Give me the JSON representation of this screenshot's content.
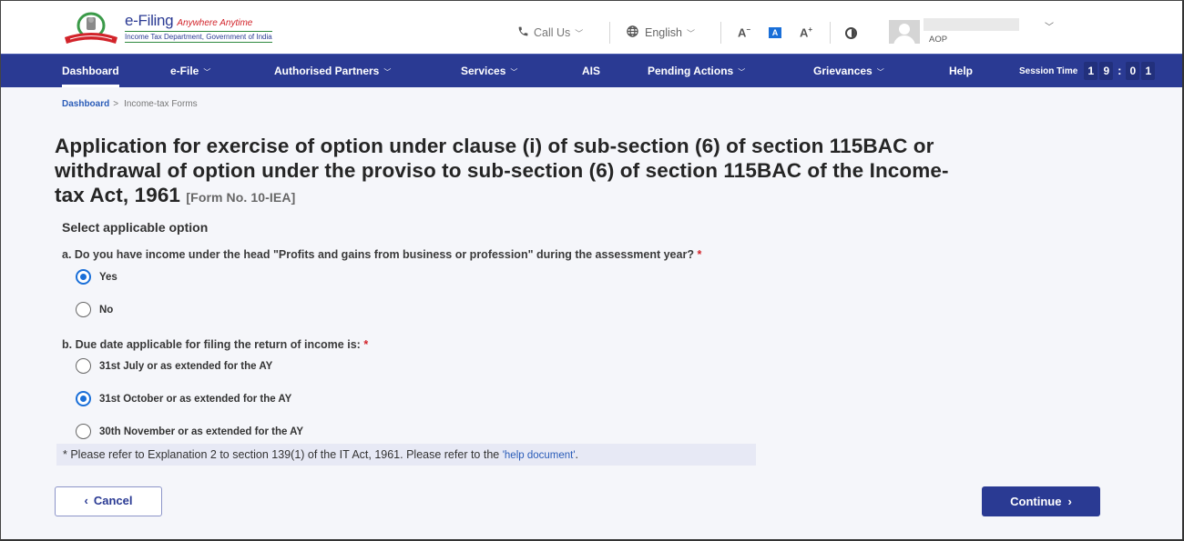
{
  "header": {
    "brand_title": "e-Filing",
    "brand_tagline": "Anywhere Anytime",
    "brand_subtitle": "Income Tax Department, Government of India",
    "call_us": "Call Us",
    "language": "English",
    "font_decrease": "A",
    "font_default": "A",
    "font_increase": "A",
    "user_role": "AOP"
  },
  "nav": {
    "items": [
      {
        "label": "Dashboard",
        "dropdown": false,
        "active": true
      },
      {
        "label": "e-File",
        "dropdown": true
      },
      {
        "label": "Authorised Partners",
        "dropdown": true
      },
      {
        "label": "Services",
        "dropdown": true
      },
      {
        "label": "AIS",
        "dropdown": false
      },
      {
        "label": "Pending Actions",
        "dropdown": true
      },
      {
        "label": "Grievances",
        "dropdown": true
      },
      {
        "label": "Help",
        "dropdown": false
      }
    ],
    "session_label": "Session Time",
    "session_digits": [
      "1",
      "9",
      "0",
      "1"
    ],
    "session_separator": ":"
  },
  "breadcrumb": {
    "items": [
      {
        "label": "Dashboard",
        "link": true
      },
      {
        "label": "Income-tax Forms",
        "link": false
      }
    ],
    "separator": ">"
  },
  "page": {
    "title": "Application for exercise of option under clause (i) of sub-section (6) of section 115BAC or withdrawal of option under the proviso to sub-section (6) of section 115BAC of the Income-tax Act, 1961",
    "form_no": "[Form No. 10-IEA]",
    "section_heading": "Select applicable option"
  },
  "form": {
    "q_a": {
      "label": "a. Do you have income under the head \"Profits and gains from business or profession\" during the assessment year?",
      "required_mark": "*",
      "options": [
        {
          "label": "Yes",
          "checked": true
        },
        {
          "label": "No",
          "checked": false
        }
      ]
    },
    "q_b": {
      "label": "b. Due date applicable for filing the return of income is:",
      "required_mark": "*",
      "options": [
        {
          "label": "31st July or as extended for the AY",
          "checked": false
        },
        {
          "label": "31st October or as extended for the AY",
          "checked": true
        },
        {
          "label": "30th November or as extended for the AY",
          "checked": false
        }
      ]
    },
    "note_text": "* Please refer to Explanation 2 to section 139(1) of the IT Act, 1961. Please refer to the ",
    "note_link": "'help document'",
    "note_end": "."
  },
  "actions": {
    "cancel_icon": "‹",
    "cancel_label": "Cancel",
    "continue_label": "Continue",
    "continue_icon": "›"
  },
  "colors": {
    "primary": "#2a3a93",
    "accent": "#1a6fd8",
    "required": "#d2232a",
    "link": "#2a5cb8"
  }
}
